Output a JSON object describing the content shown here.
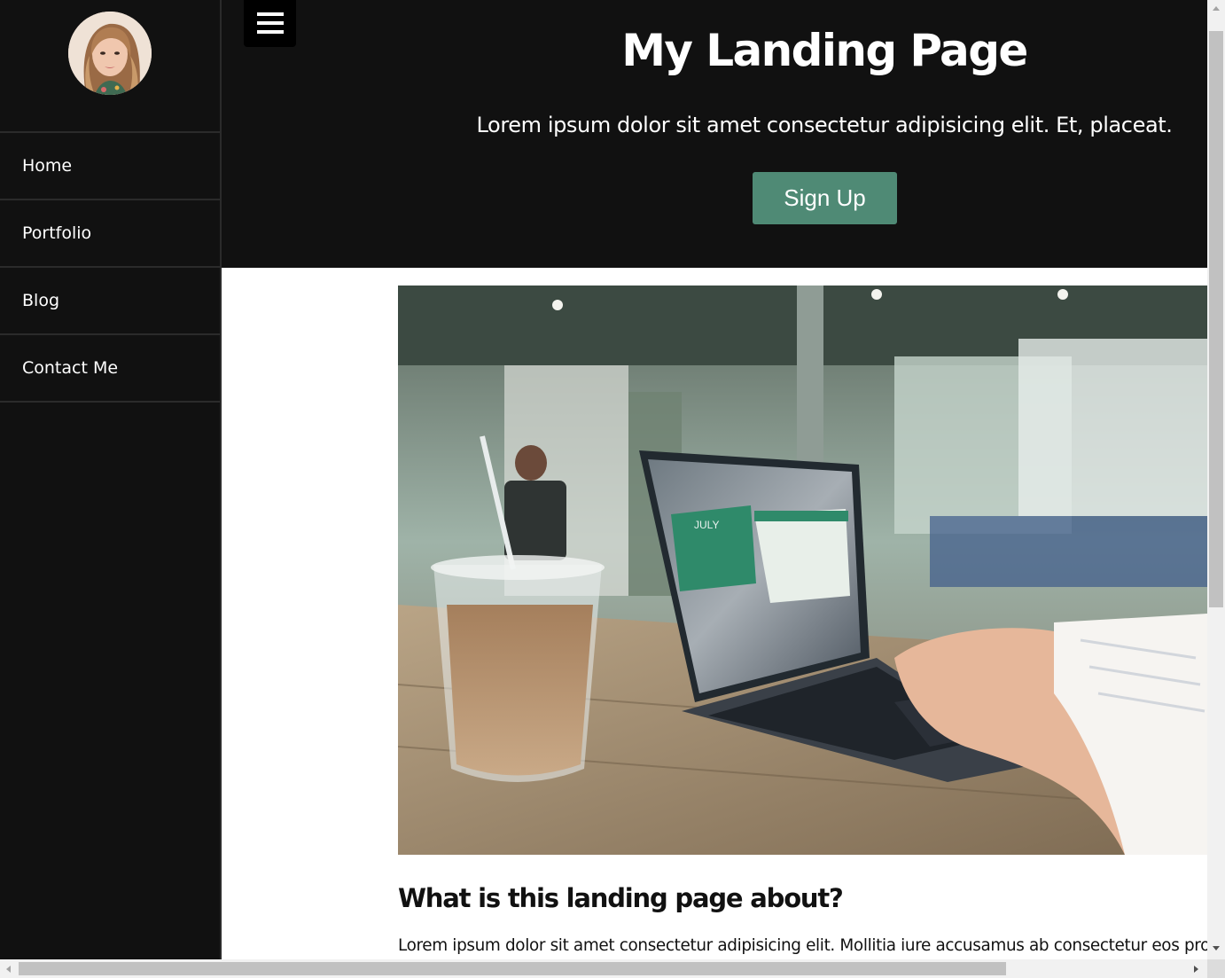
{
  "sidebar": {
    "avatar_icon": "profile-photo",
    "items": [
      {
        "label": "Home"
      },
      {
        "label": "Portfolio"
      },
      {
        "label": "Blog"
      },
      {
        "label": "Contact Me"
      }
    ]
  },
  "header": {
    "menu_icon": "hamburger-menu-icon",
    "title": "My Landing Page",
    "subtitle": "Lorem ipsum dolor sit amet consectetur adipisicing elit. Et, placeat.",
    "signup_label": "Sign Up"
  },
  "main": {
    "hero_image": "laptop-and-iced-coffee-on-cafe-table",
    "section_heading": "What is this landing page about?",
    "section_body": "Lorem ipsum dolor sit amet consectetur adipisicing elit. Mollitia iure accusamus ab consectetur eos provid"
  },
  "theme": {
    "dark_bg": "#111111",
    "accent": "#4f8a75",
    "text_light": "#ffffff",
    "text_dark": "#111111"
  }
}
